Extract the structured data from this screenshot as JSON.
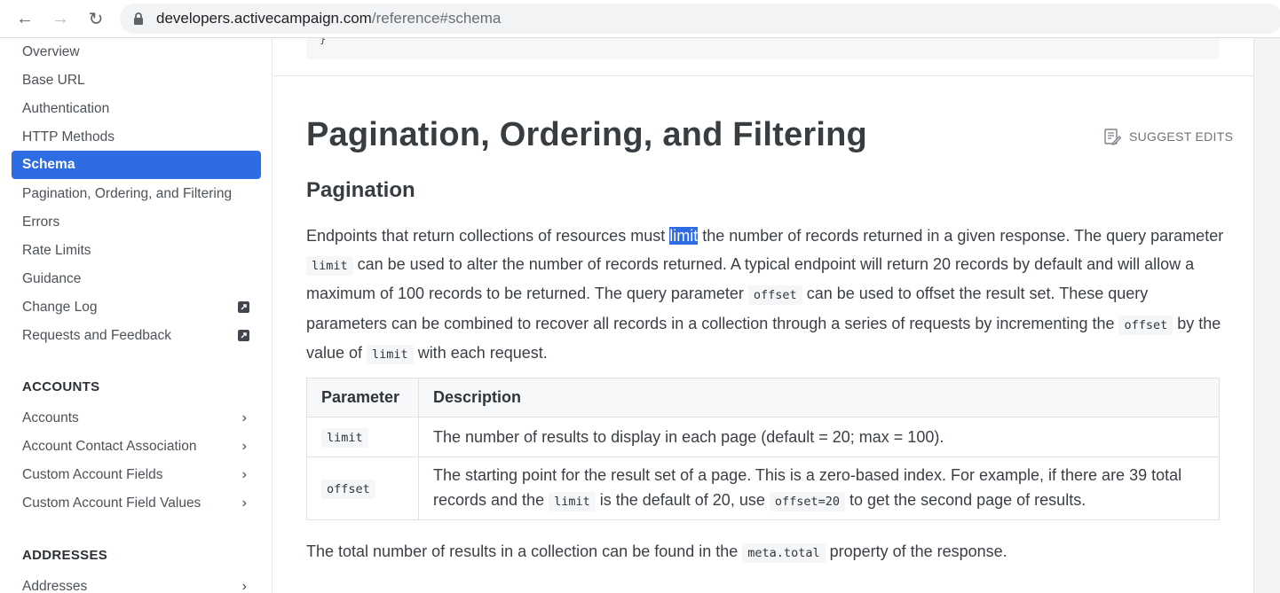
{
  "browser": {
    "url_host": "developers.activecampaign.com",
    "url_path": "/reference#schema"
  },
  "sidebar": {
    "items": [
      {
        "label": "Overview"
      },
      {
        "label": "Base URL"
      },
      {
        "label": "Authentication"
      },
      {
        "label": "HTTP Methods"
      },
      {
        "label": "Schema"
      },
      {
        "label": "Pagination, Ordering, and Filtering"
      },
      {
        "label": "Errors"
      },
      {
        "label": "Rate Limits"
      },
      {
        "label": "Guidance"
      },
      {
        "label": "Change Log"
      },
      {
        "label": "Requests and Feedback"
      }
    ],
    "accounts_heading": "ACCOUNTS",
    "accounts_items": [
      {
        "label": "Accounts"
      },
      {
        "label": "Account Contact Association"
      },
      {
        "label": "Custom Account Fields"
      },
      {
        "label": "Custom Account Field Values"
      }
    ],
    "addresses_heading": "ADDRESSES",
    "addresses_items": [
      {
        "label": "Addresses"
      }
    ]
  },
  "main": {
    "code_tail": "}",
    "title": "Pagination, Ordering, and Filtering",
    "suggest_edits": "SUGGEST EDITS",
    "subtitle": "Pagination",
    "para": {
      "t1": "Endpoints that return collections of resources must ",
      "highlight": "limit",
      "t2": " the number of records returned in a given response. The query parameter ",
      "c1": "limit",
      "t3": " can be used to alter the number of records returned. A typical endpoint will return 20 records by default and will allow a maximum of 100 records to be returned. The query parameter ",
      "c2": "offset",
      "t4": " can be used to offset the result set. These query parameters can be combined to recover all records in a collection through a series of requests by incrementing the ",
      "c3": "offset",
      "t5": " by the value of ",
      "c4": "limit",
      "t6": " with each request."
    },
    "table": {
      "headers": [
        "Parameter",
        "Description"
      ],
      "row1": {
        "param": "limit",
        "desc": "The number of results to display in each page (default = 20; max = 100)."
      },
      "row2": {
        "param": "offset",
        "d1": "The starting point for the result set of a page. This is a zero-based index. For example, if there are 39 total records and the ",
        "c1": "limit",
        "d2": " is the default of 20, use ",
        "c2": "offset=20",
        "d3": " to get the second page of results."
      }
    },
    "footer": {
      "t1": "The total number of results in a collection can be found in the ",
      "c1": "meta.total",
      "t2": " property of the response."
    }
  }
}
